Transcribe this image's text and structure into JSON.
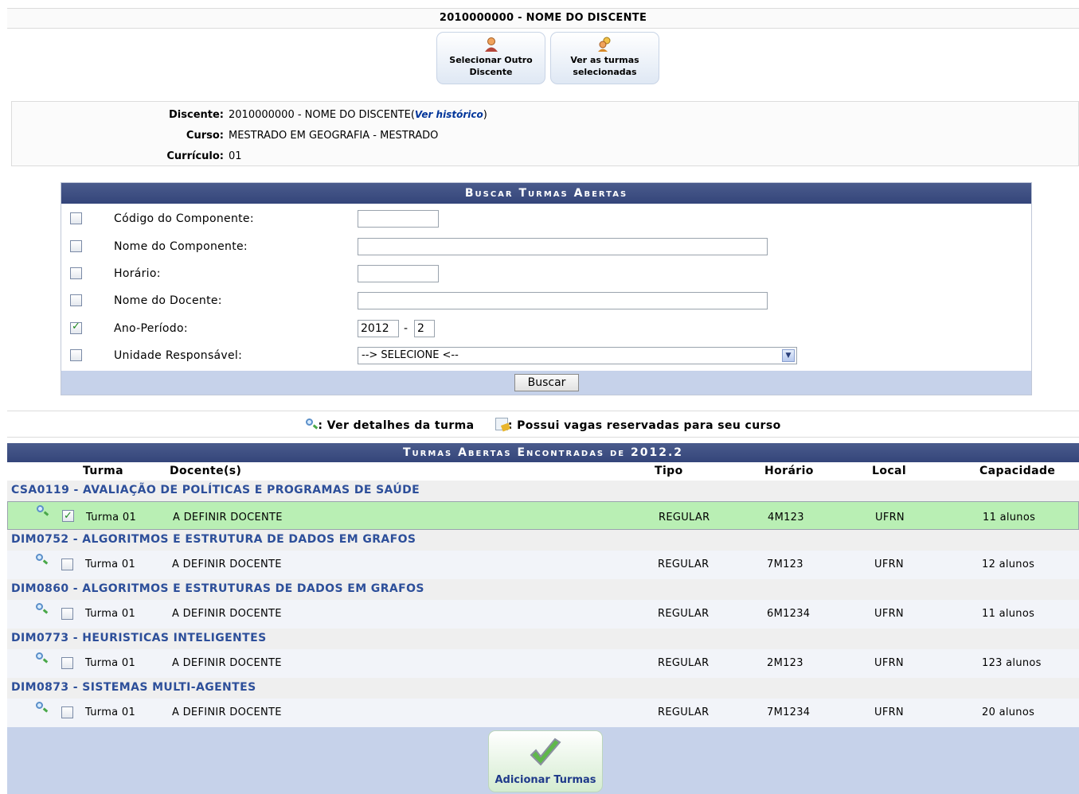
{
  "header": {
    "title": "2010000000 - NOME DO DISCENTE"
  },
  "actions": {
    "select_other": [
      "Selecionar Outro",
      "Discente"
    ],
    "view_selected": [
      "Ver as turmas",
      "selecionadas"
    ]
  },
  "student": {
    "discente_label": "Discente:",
    "discente_value": "2010000000 - NOME DO DISCENTE(",
    "historico_link": "Ver histórico",
    "historico_close": ")",
    "curso_label": "Curso:",
    "curso_value": "MESTRADO EM GEOGRAFIA - MESTRADO",
    "curriculo_label": "Currículo:",
    "curriculo_value": "01"
  },
  "search": {
    "title": "Buscar Turmas Abertas",
    "fields": [
      {
        "label": "Código do Componente:",
        "checked": false,
        "value": ""
      },
      {
        "label": "Nome do Componente:",
        "checked": false,
        "value": ""
      },
      {
        "label": "Horário:",
        "checked": false,
        "value": ""
      },
      {
        "label": "Nome do Docente:",
        "checked": false,
        "value": ""
      },
      {
        "label": "Ano-Período:",
        "checked": true,
        "year": "2012",
        "separator": "-",
        "period": "2"
      },
      {
        "label": "Unidade Responsável:",
        "checked": false,
        "value": "--> SELECIONE <--"
      }
    ],
    "submit": "Buscar"
  },
  "legend": {
    "details": ": Ver detalhes da turma",
    "reserved": ": Possui vagas reservadas para seu curso"
  },
  "results": {
    "title": "Turmas Abertas Encontradas de 2012.2",
    "columns": [
      "Turma",
      "Docente(s)",
      "Tipo",
      "Horário",
      "Local",
      "Capacidade"
    ],
    "groups": [
      {
        "name": "CSA0119 - AVALIAÇÃO DE POLÍTICAS E PROGRAMAS DE SAÚDE",
        "turma": "Turma 01",
        "docente": "A DEFINIR DOCENTE",
        "tipo": "REGULAR",
        "horario": "4M123",
        "local": "UFRN",
        "capacidade": "11 alunos",
        "checked": true
      },
      {
        "name": "DIM0752 - ALGORITMOS E ESTRUTURA DE DADOS EM GRAFOS",
        "turma": "Turma 01",
        "docente": "A DEFINIR DOCENTE",
        "tipo": "REGULAR",
        "horario": "7M123",
        "local": "UFRN",
        "capacidade": "12 alunos",
        "checked": false
      },
      {
        "name": "DIM0860 - ALGORITMOS E ESTRUTURAS DE DADOS EM GRAFOS",
        "turma": "Turma 01",
        "docente": "A DEFINIR DOCENTE",
        "tipo": "REGULAR",
        "horario": "6M1234",
        "local": "UFRN",
        "capacidade": "11 alunos",
        "checked": false
      },
      {
        "name": "DIM0773 - HEURISTICAS INTELIGENTES",
        "turma": "Turma 01",
        "docente": "A DEFINIR DOCENTE",
        "tipo": "REGULAR",
        "horario": "2M123",
        "local": "UFRN",
        "capacidade": "123 alunos",
        "checked": false
      },
      {
        "name": "DIM0873 - SISTEMAS MULTI-AGENTES",
        "turma": "Turma 01",
        "docente": "A DEFINIR DOCENTE",
        "tipo": "REGULAR",
        "horario": "7M1234",
        "local": "UFRN",
        "capacidade": "20 alunos",
        "checked": false
      }
    ],
    "add_button": "Adicionar Turmas"
  },
  "colors": {
    "caption_bg": "#3c4d80",
    "selected_row": "#b9efb4",
    "group_text": "#2d4f9a",
    "footer_bg": "#c6d2ea"
  }
}
